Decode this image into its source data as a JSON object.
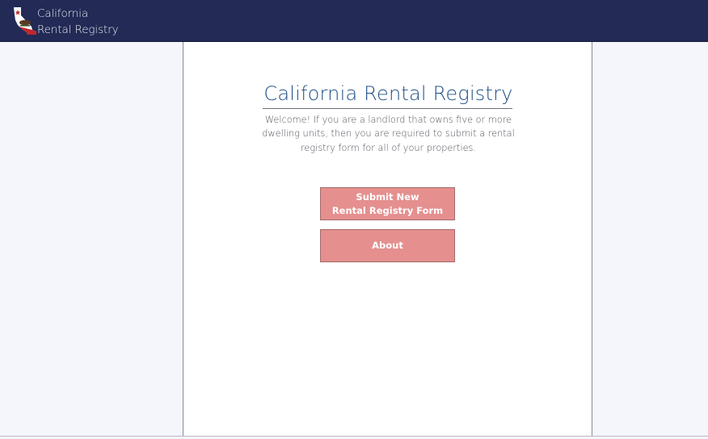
{
  "header": {
    "brand_line1": "California",
    "brand_line2": "Rental Registry",
    "logo_icon": "california-flag-map-icon",
    "background_color": "#222a55"
  },
  "main": {
    "title": "California Rental Registry",
    "welcome_text": "Welcome! If you are a landlord that owns five or more dwelling units, then you are required to submit a rental registry form for all of your properties.",
    "buttons": {
      "submit_line1": "Submit New",
      "submit_line2": "Rental Registry Form",
      "about": "About"
    },
    "button_color": "#e58f8f",
    "title_color": "#1f4f86"
  }
}
